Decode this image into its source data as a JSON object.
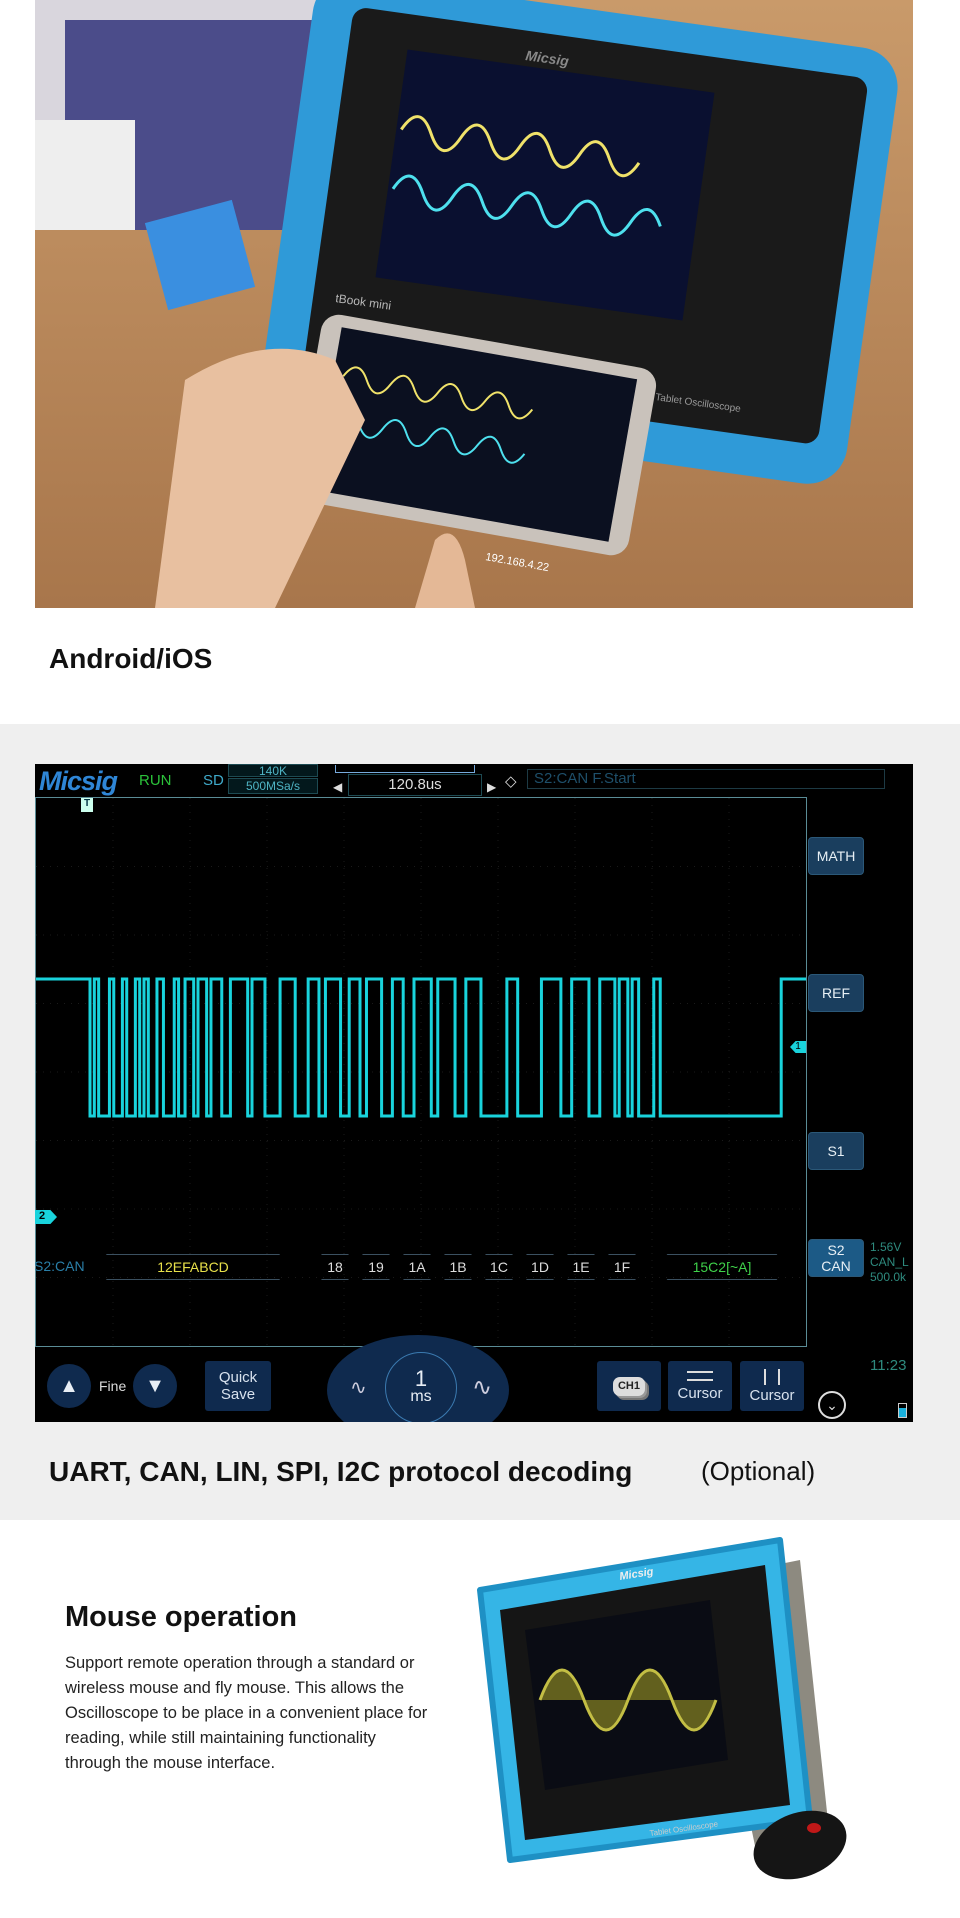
{
  "section1": {
    "heading": "Android/iOS",
    "phone_ip": "192.168.4.22",
    "tablet_brand": "Micsig",
    "tablet_model": "tBook mini",
    "tablet_caption": "Tablet Oscilloscope"
  },
  "scope": {
    "logo": "Micsig",
    "run_state": "RUN",
    "storage": "SD",
    "memory_depth": "140K",
    "sample_rate": "500MSa/s",
    "time_offset": "120.8us",
    "trigger_info": "S2:CAN F.Start",
    "trigger_marker": "T",
    "ch1_marker": "1",
    "ch2_marker": "2",
    "right_buttons": [
      "MATH",
      "REF",
      "S1",
      "S2\nCAN"
    ],
    "s2_info": [
      "1.56V",
      "CAN_L",
      "500.0k"
    ],
    "decode": {
      "label": "S2:CAN",
      "id": "12EFABCD",
      "bytes": [
        "18",
        "19",
        "1A",
        "1B",
        "1C",
        "1D",
        "1E",
        "1F"
      ],
      "crc": "15C2[~A]"
    },
    "bottom": {
      "fine_label": "Fine",
      "quick_save": "Quick Save",
      "timebase_value": "1",
      "timebase_unit": "ms",
      "ch_button": "CH1",
      "cursor_h": "Cursor",
      "cursor_v": "Cursor",
      "clock": "11:23"
    },
    "colors": {
      "trace": "#19d3dc",
      "id_text": "#e8e04a",
      "crc_text": "#3fd14a",
      "run": "#2bc23a"
    }
  },
  "section2": {
    "caption": "UART, CAN, LIN, SPI, I2C protocol decoding",
    "optional": "(Optional)"
  },
  "section3": {
    "heading": "Mouse operation",
    "body": "Support remote operation through a standard or wireless mouse and fly mouse. This allows the Oscilloscope to be place in a convenient place for reading, while still maintaining functionality through the mouse interface.",
    "device_brand": "Micsig",
    "device_caption": "Tablet Oscilloscope"
  }
}
